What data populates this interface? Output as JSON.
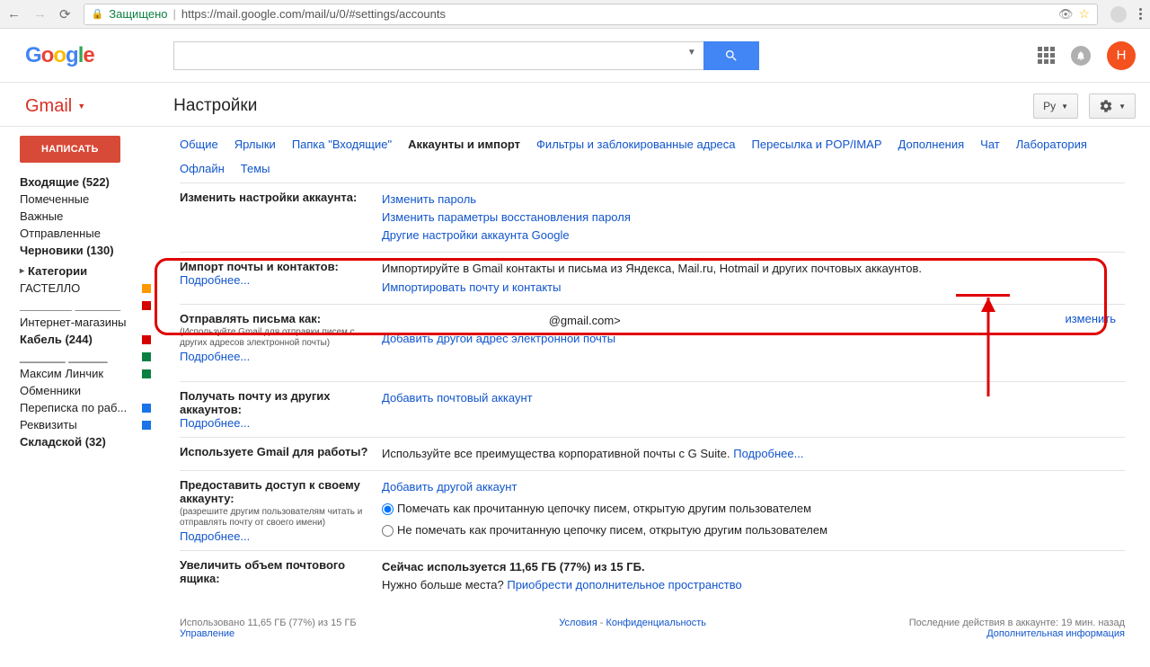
{
  "browser": {
    "secure": "Защищено",
    "url": "https://mail.google.com/mail/u/0/#settings/accounts"
  },
  "header": {
    "avatar_initial": "Н"
  },
  "title": {
    "gmail": "Gmail",
    "page": "Настройки",
    "lang": "Ру"
  },
  "sidebar": {
    "compose": "НАПИСАТЬ",
    "folders": [
      {
        "label": "Входящие (522)",
        "bold": true
      },
      {
        "label": "Помеченные"
      },
      {
        "label": "Важные"
      },
      {
        "label": "Отправленные"
      },
      {
        "label": "Черновики (130)",
        "bold": true
      }
    ],
    "categories_label": "Категории",
    "labels": [
      {
        "label": "ГАСТЕЛЛО",
        "color": "#ff9800"
      },
      {
        "label": "________   _______",
        "color": "#d50000",
        "bold": true
      },
      {
        "label": "Интернет-магазины"
      },
      {
        "label": "Кабель (244)",
        "color": "#d50000",
        "bold": true
      },
      {
        "label": "_______  ______",
        "color": "#0b8043"
      },
      {
        "label": "Максим Линчик",
        "color": "#0b8043"
      },
      {
        "label": "Обменники"
      },
      {
        "label": "Переписка по раб...",
        "color": "#1a73e8"
      },
      {
        "label": "Реквизиты",
        "color": "#1a73e8"
      },
      {
        "label": "Складской (32)",
        "bold": true
      }
    ]
  },
  "tabs": [
    "Общие",
    "Ярлыки",
    "Папка \"Входящие\"",
    "Аккаунты и импорт",
    "Фильтры и заблокированные адреса",
    "Пересылка и POP/IMAP",
    "Дополнения",
    "Чат",
    "Лаборатория",
    "Офлайн",
    "Темы"
  ],
  "active_tab": "Аккаунты и импорт",
  "rows": {
    "account": {
      "title": "Изменить настройки аккаунта:",
      "links": [
        "Изменить пароль",
        "Изменить параметры восстановления пароля",
        "Другие настройки аккаунта Google"
      ]
    },
    "import": {
      "title": "Импорт почты и контактов:",
      "more": "Подробнее...",
      "text": "Импортируйте в Gmail контакты и письма из Яндекса, Mail.ru, Hotmail и других почтовых аккаунтов.",
      "link": "Импортировать почту и контакты"
    },
    "sendas": {
      "title": "Отправлять письма как:",
      "sub": "(Используйте Gmail для отправки писем с других адресов электронной почты)",
      "more": "Подробнее...",
      "email_suffix": "@gmail.com>",
      "add": "Добавить другой адрес электронной почты",
      "edit": "изменить"
    },
    "receive": {
      "title": "Получать почту из других аккаунтов:",
      "more": "Подробнее...",
      "link": "Добавить почтовый аккаунт"
    },
    "work": {
      "title": "Используете Gmail для работы?",
      "text": "Используйте все преимущества корпоративной почты с G Suite.",
      "more": "Подробнее..."
    },
    "grant": {
      "title": "Предоставить доступ к своему аккаунту:",
      "sub": "(разрешите другим пользователям читать и отправлять почту от своего имени)",
      "more": "Подробнее...",
      "link": "Добавить другой аккаунт",
      "radio1": "Помечать как прочитанную цепочку писем, открытую другим пользователем",
      "radio2": "Не помечать как прочитанную цепочку писем, открытую другим пользователем"
    },
    "storage": {
      "title": "Увеличить объем почтового ящика:",
      "text": "Сейчас используется 11,65 ГБ (77%) из 15 ГБ.",
      "text2": "Нужно больше места?",
      "link": "Приобрести дополнительное пространство"
    }
  },
  "footer": {
    "left1": "Использовано 11,65 ГБ (77%) из 15 ГБ",
    "left2": "Управление",
    "mid1": "Условия",
    "mid2": "Конфиденциальность",
    "right1": "Последние действия в аккаунте: 19 мин. назад",
    "right2": "Дополнительная информация"
  }
}
